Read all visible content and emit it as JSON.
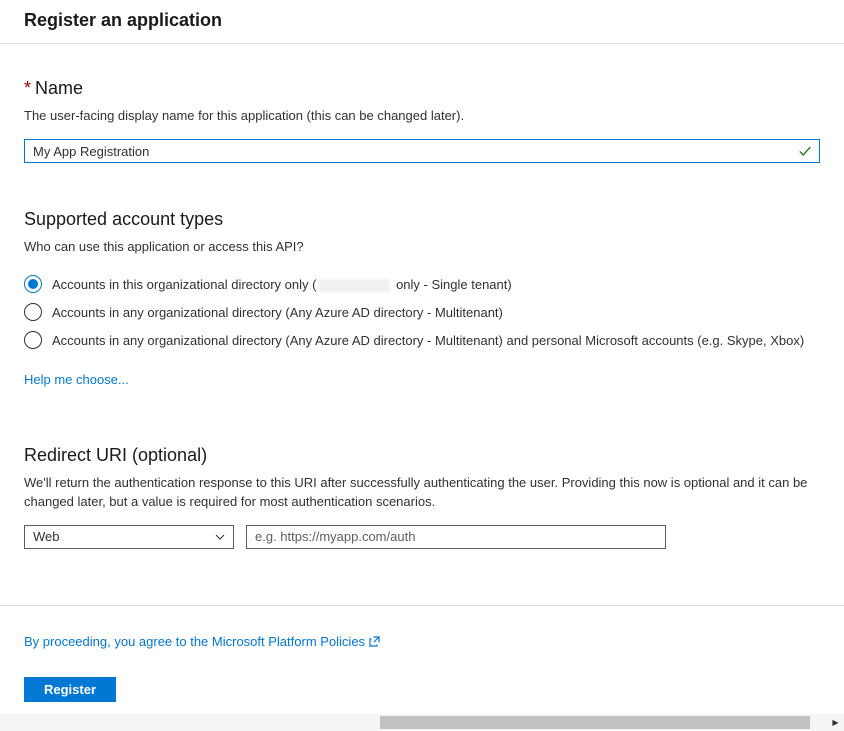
{
  "pageTitle": "Register an application",
  "name": {
    "label": "Name",
    "desc": "The user-facing display name for this application (this can be changed later).",
    "value": "My App Registration"
  },
  "accountTypes": {
    "label": "Supported account types",
    "desc": "Who can use this application or access this API?",
    "options": {
      "opt0_prefix": "Accounts in this organizational directory only (",
      "opt0_suffix": " only - Single tenant)",
      "opt1": "Accounts in any organizational directory (Any Azure AD directory - Multitenant)",
      "opt2": "Accounts in any organizational directory (Any Azure AD directory - Multitenant) and personal Microsoft accounts (e.g. Skype, Xbox)"
    },
    "helpLink": "Help me choose..."
  },
  "redirect": {
    "label": "Redirect URI (optional)",
    "desc": "We'll return the authentication response to this URI after successfully authenticating the user. Providing this now is optional and it can be changed later, but a value is required for most authentication scenarios.",
    "platformSelected": "Web",
    "placeholder": "e.g. https://myapp.com/auth"
  },
  "footer": {
    "policyText": "By proceeding, you agree to the Microsoft Platform Policies",
    "registerBtn": "Register"
  }
}
